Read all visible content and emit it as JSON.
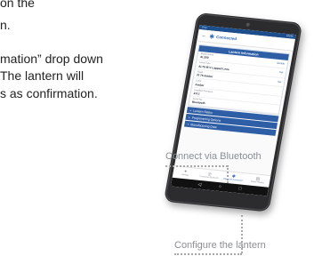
{
  "instructions": {
    "line1": "on the",
    "line2": "n.",
    "line3": "mation” drop down",
    "line4": "The lantern will",
    "line5": "s as confirmation."
  },
  "callouts": {
    "connect": "Connect via Bluetooth",
    "configure": "Configure the lantern"
  },
  "tablet": {
    "status_left": "9:41",
    "status_right": "100%",
    "app_title": "Connected",
    "lantern_info": {
      "header": "Lantern Information",
      "rows": [
        {
          "label": "Model Name",
          "value": "AL200",
          "action": "Identify"
        },
        {
          "label": "Lamp Type",
          "value": "AL75 M-V Lapped Lens",
          "action": "Set"
        },
        {
          "label": "Flash",
          "value": "Fl 75 Amber",
          "action": "Set"
        },
        {
          "label": "Color",
          "value": "Amber",
          "action": ""
        },
        {
          "label": "Installed Firmware",
          "value": "2.0.1",
          "action": ""
        },
        {
          "label": "Serial No.",
          "value": "Bluetooth",
          "action": ""
        }
      ]
    },
    "collapsed_sections": [
      "Lantern Status",
      "Programming Options",
      "Manufacturing Data"
    ],
    "bottom_nav": [
      {
        "icon": "✦",
        "label": "Settings"
      },
      {
        "icon": "◎",
        "label": "Connected Bluetooth"
      },
      {
        "icon": "✱",
        "label": "Bluetooth Connection"
      },
      {
        "icon": "▤",
        "label": "Delete Reader"
      }
    ],
    "active_tab": 2,
    "android_nav": {
      "back": "◁",
      "home": "○",
      "recent": "□"
    }
  },
  "colors": {
    "accent": "#2e5ea6",
    "status_bar": "#1c4e8e",
    "callout_text": "#8a8e94"
  }
}
